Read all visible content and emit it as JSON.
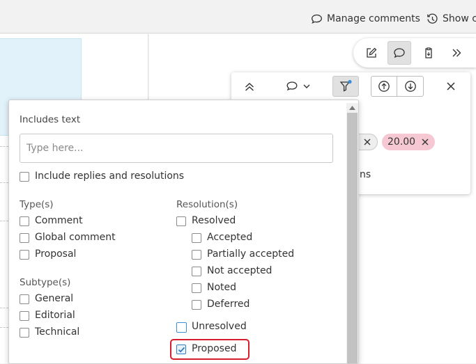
{
  "header": {
    "manage_comments_label": "Manage comments",
    "show_changes_label": "Show cl"
  },
  "view_toolbar": {
    "buttons": [
      {
        "icon": "edit-icon"
      },
      {
        "icon": "comment-icon",
        "active": true
      },
      {
        "icon": "clipboard-icon"
      },
      {
        "icon": "double-chevron-right-icon"
      }
    ]
  },
  "comments_panel": {
    "chips": [
      {
        "label": "",
        "color": "#eeeeee"
      },
      {
        "label": "20.00",
        "color": "#f6c8d4"
      }
    ],
    "partial_text": "ns",
    "filter_active_indicator_color": "#3b8fd6"
  },
  "filter_dropdown": {
    "includes_text_label": "Includes text",
    "search_placeholder": "Type here...",
    "search_value": "",
    "include_replies_label": "Include replies and resolutions",
    "types_label": "Type(s)",
    "types": [
      {
        "label": "Comment",
        "checked": false
      },
      {
        "label": "Global comment",
        "checked": false
      },
      {
        "label": "Proposal",
        "checked": false
      }
    ],
    "subtypes_label": "Subtype(s)",
    "subtypes": [
      {
        "label": "General",
        "checked": false
      },
      {
        "label": "Editorial",
        "checked": false
      },
      {
        "label": "Technical",
        "checked": false
      }
    ],
    "resolutions_label": "Resolution(s)",
    "resolved": {
      "label": "Resolved",
      "checked": false
    },
    "resolved_children": [
      {
        "label": "Accepted",
        "checked": false
      },
      {
        "label": "Partially accepted",
        "checked": false
      },
      {
        "label": "Not accepted",
        "checked": false
      },
      {
        "label": "Noted",
        "checked": false
      },
      {
        "label": "Deferred",
        "checked": false
      }
    ],
    "unresolved": {
      "label": "Unresolved",
      "checked": false
    },
    "proposed": {
      "label": "Proposed",
      "checked": true
    }
  },
  "colors": {
    "highlight": "#d61d2b",
    "checkbox_accent": "#2f7cc2"
  }
}
